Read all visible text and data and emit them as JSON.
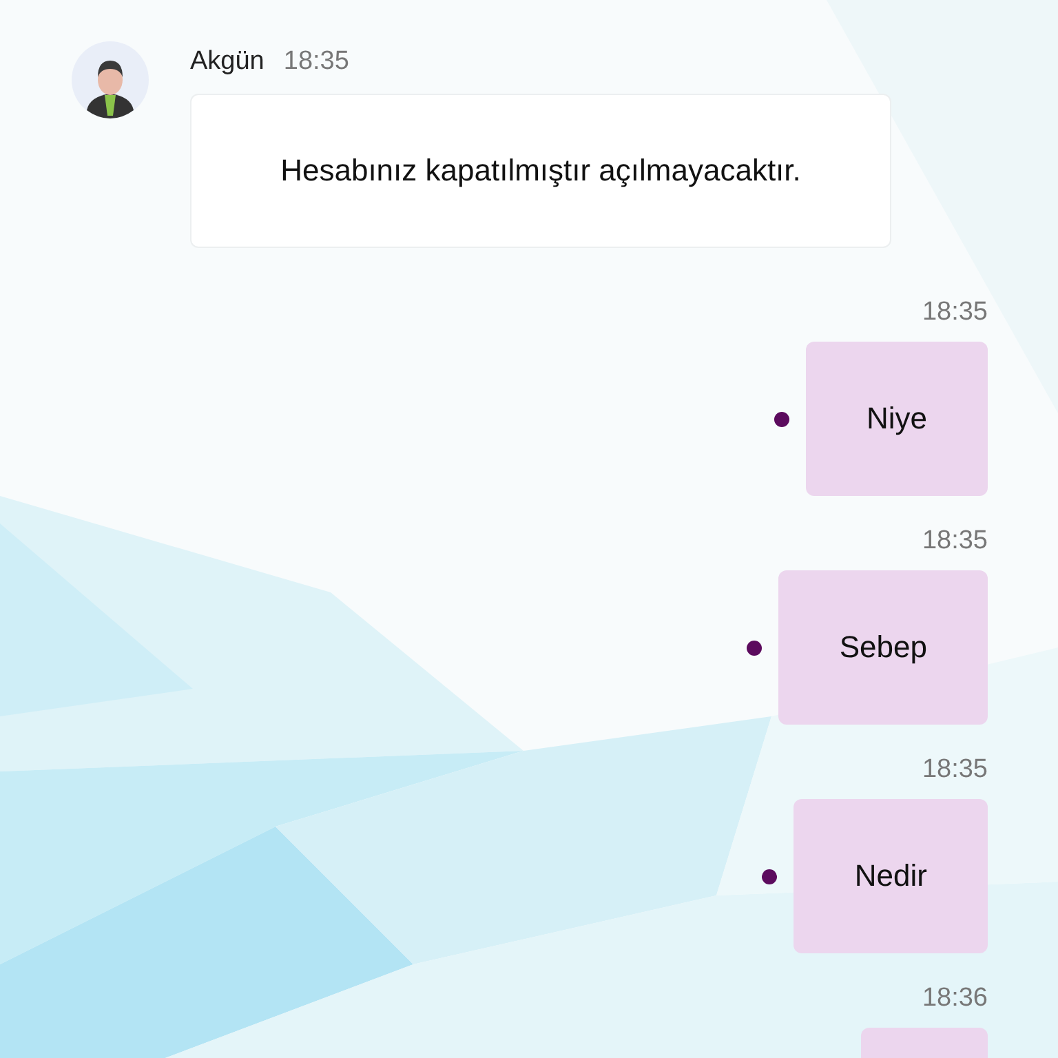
{
  "incoming": {
    "sender": "Akgün",
    "time": "18:35",
    "text": "Hesabınız kapatılmıştır açılmayacaktır."
  },
  "outgoing": [
    {
      "time": "18:35",
      "text": "Niye",
      "dot": true
    },
    {
      "time": "18:35",
      "text": "Sebep",
      "dot": true
    },
    {
      "time": "18:35",
      "text": "Nedir",
      "dot": true
    },
    {
      "time": "18:36"
    }
  ]
}
